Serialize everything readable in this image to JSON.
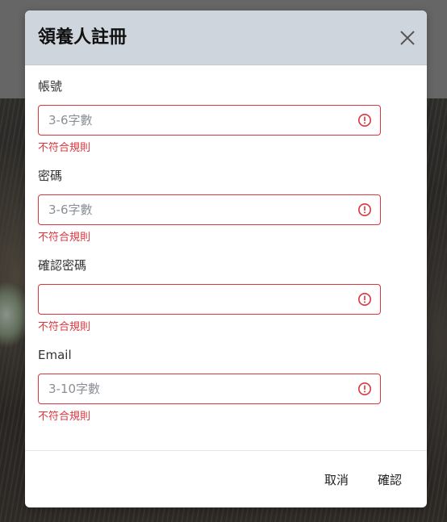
{
  "modal": {
    "title": "領養人註冊",
    "close_icon": "close-icon"
  },
  "form": {
    "fields": [
      {
        "label": "帳號",
        "value": "",
        "placeholder": "3-6字數",
        "error": "不符合規則",
        "icon": "alert-circle-icon"
      },
      {
        "label": "密碼",
        "value": "",
        "placeholder": "3-6字數",
        "error": "不符合規則",
        "icon": "alert-circle-icon"
      },
      {
        "label": "確認密碼",
        "value": "",
        "placeholder": "",
        "error": "不符合規則",
        "icon": "alert-circle-icon"
      },
      {
        "label": "Email",
        "value": "",
        "placeholder": "3-10字數",
        "error": "不符合規則",
        "icon": "alert-circle-icon"
      }
    ]
  },
  "footer": {
    "cancel_label": "取消",
    "confirm_label": "確認"
  },
  "colors": {
    "error": "#d9363e",
    "header_bg": "#cfd5dc"
  }
}
